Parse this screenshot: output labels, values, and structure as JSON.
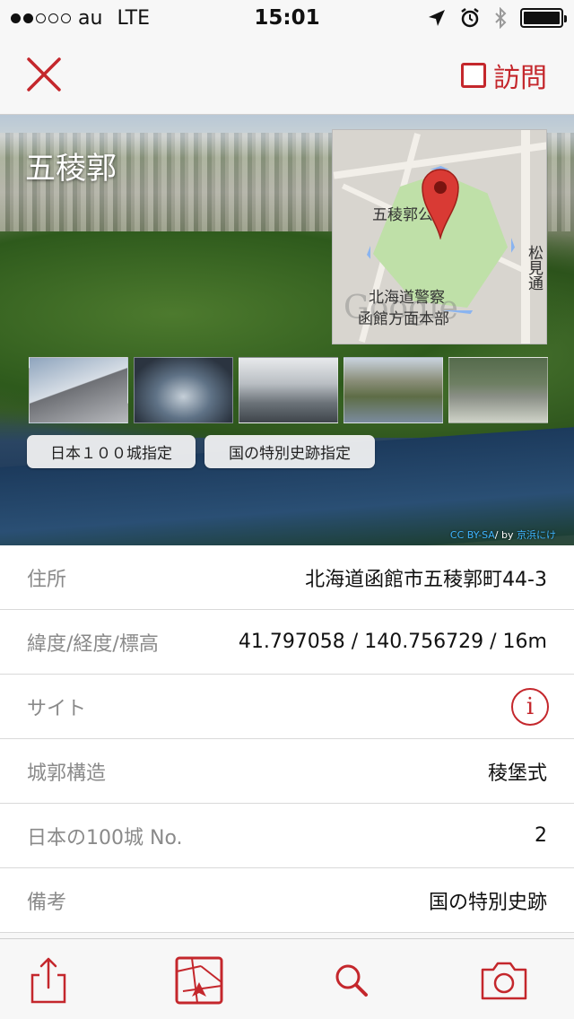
{
  "status_bar": {
    "carrier": "au",
    "network": "LTE",
    "time": "15:01"
  },
  "nav": {
    "visit_label": "訪問"
  },
  "hero": {
    "title": "五稜郭",
    "map": {
      "park_label": "五稜郭公園",
      "police_label_1": "北海道警察",
      "police_label_2": "函館方面本部",
      "street_label": "松見通",
      "watermark": "Google"
    },
    "badges": [
      "日本１００城指定",
      "国の特別史跡指定"
    ],
    "credit": {
      "license": "CC BY-SA",
      "by": "/ by ",
      "author": "京浜にけ"
    }
  },
  "info": {
    "rows": [
      {
        "label": "住所",
        "value": "北海道函館市五稜郭町44-3"
      },
      {
        "label": "緯度/経度/標高",
        "value": "41.797058 / 140.756729 / 16m"
      },
      {
        "label": "サイト",
        "value": "i"
      },
      {
        "label": "城郭構造",
        "value": "稜堡式"
      },
      {
        "label": "日本の100城 No.",
        "value": "2"
      },
      {
        "label": "備考",
        "value": "国の特別史跡"
      }
    ]
  },
  "colors": {
    "accent": "#c4272c",
    "bar_background": "#f7f7f7"
  }
}
